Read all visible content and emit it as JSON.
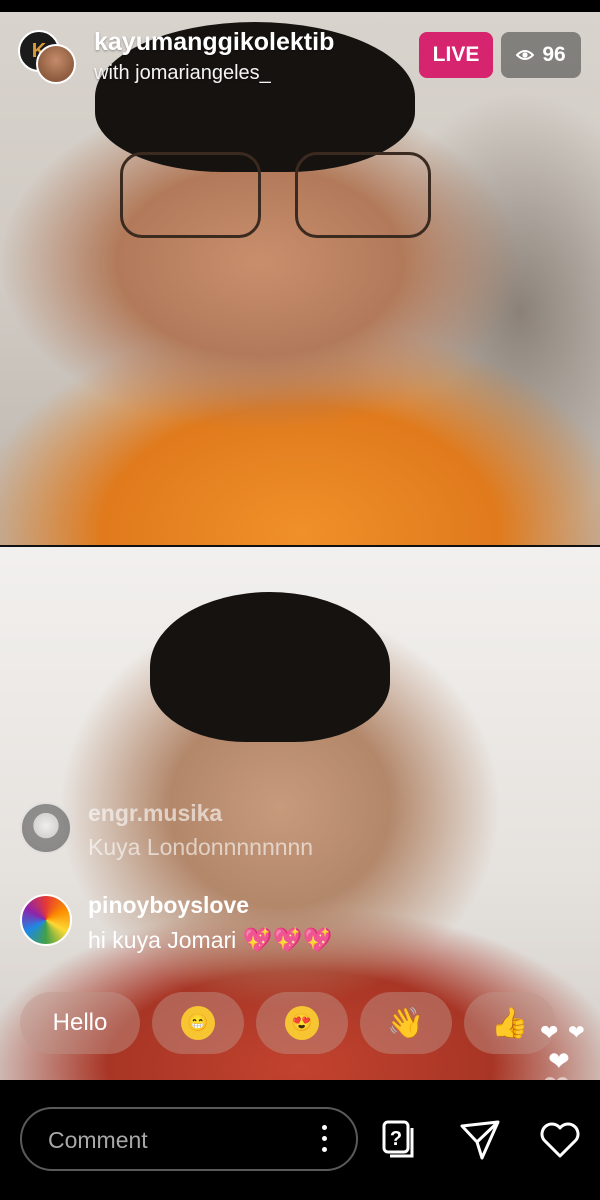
{
  "stream": {
    "host_username": "kayumanggikolektib",
    "guest_line": "with jomariangeles_",
    "live_label": "LIVE",
    "viewer_count": "96",
    "host_avatar_letter": "K"
  },
  "comments": [
    {
      "username": "engr.musika",
      "text": "Kuya Londonnnnnnnn"
    },
    {
      "username": "pinoyboyslove",
      "text": "hi kuya Jomari",
      "hearts": "💖💖💖"
    }
  ],
  "quick_replies": [
    {
      "label": "Hello"
    },
    {
      "emoji": "😁",
      "icon": "grinning-face-icon"
    },
    {
      "emoji": "😍",
      "icon": "heart-eyes-face-icon"
    },
    {
      "emoji": "👋",
      "icon": "waving-hand-icon"
    },
    {
      "emoji": "👍",
      "icon": "thumbs-up-icon"
    }
  ],
  "bottom_bar": {
    "comment_placeholder": "Comment",
    "icons": [
      "more-options-icon",
      "question-icon",
      "share-icon",
      "like-heart-icon"
    ]
  },
  "colors": {
    "live_badge": "#d6246e",
    "viewer_badge": "#3c3c3c",
    "chip_bg": "#be968c"
  }
}
